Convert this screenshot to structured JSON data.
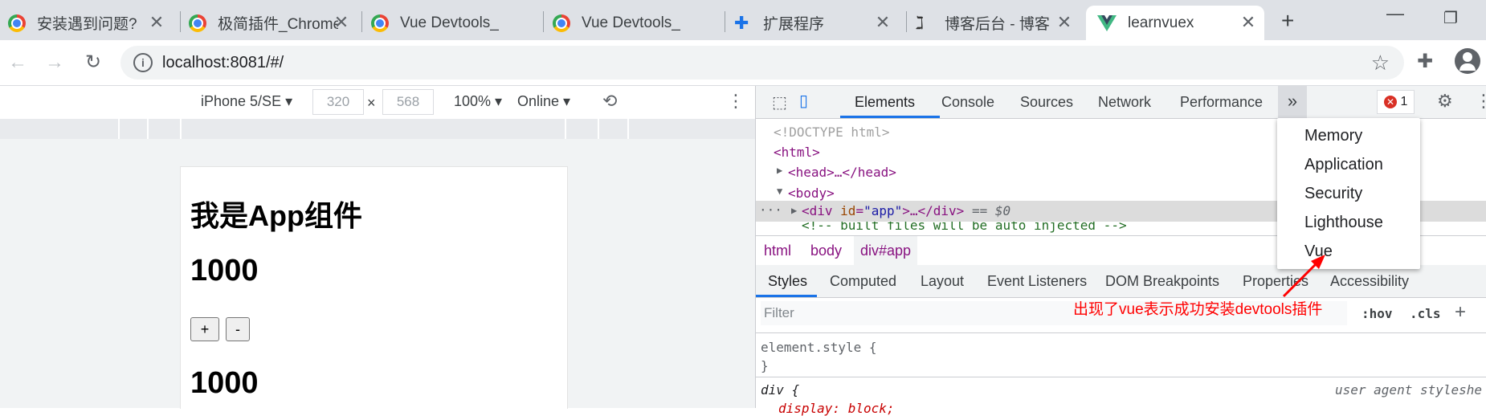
{
  "tabs": [
    {
      "title": "安装遇到问题?",
      "icon": "chrome-icon"
    },
    {
      "title": "极简插件_Chrome",
      "icon": "chrome-icon"
    },
    {
      "title": "Vue Devtools_",
      "icon": "chrome-icon"
    },
    {
      "title": "Vue Devtools_",
      "icon": "chrome-icon"
    },
    {
      "title": "扩展程序",
      "icon": "puzzle-icon"
    },
    {
      "title": "博客后台 - 博客",
      "icon": "blog-icon"
    },
    {
      "title": "learnvuex",
      "icon": "vue-icon"
    }
  ],
  "address": {
    "url": "localhost:8081/#/"
  },
  "device_toolbar": {
    "device": "iPhone 5/SE",
    "width": "320",
    "x": "×",
    "height": "568",
    "zoom": "100%",
    "network": "Online"
  },
  "page": {
    "heading": "我是App组件",
    "counter1": "1000",
    "plus": "+",
    "minus": "-",
    "counter2": "1000"
  },
  "devtools": {
    "tabs": [
      "Elements",
      "Console",
      "Sources",
      "Network",
      "Performance"
    ],
    "more": "»",
    "errors": "1",
    "dom": {
      "doctype": "<!DOCTYPE html>",
      "html": "<html>",
      "head": "<head>…</head>",
      "body": "<body>",
      "div_open": "<div",
      "div_attr": "id",
      "div_eq": "=",
      "div_val": "\"app\"",
      "div_close": ">…</div>",
      "eq0": "== $0",
      "comment": "<!-- built files will be auto injected -->"
    },
    "breadcrumbs": [
      "html",
      "body",
      "div#app"
    ],
    "subtabs": [
      "Styles",
      "Computed",
      "Layout",
      "Event Listeners",
      "DOM Breakpoints",
      "Properties",
      "Accessibility"
    ],
    "filter_placeholder": "Filter",
    "hov": ":hov",
    "cls": ".cls",
    "plus": "+",
    "style_rules": {
      "element_style": "element.style {",
      "close": "}",
      "div_rule": "div {",
      "ua": "user agent styleshe",
      "display": "display: block;"
    },
    "overflow_menu": [
      "Memory",
      "Application",
      "Security",
      "Lighthouse",
      "Vue"
    ]
  },
  "annotation": {
    "text": "出现了vue表示成功安装devtools插件",
    "color": "#ff0000"
  },
  "colors": {
    "accent": "#1a73e8",
    "vue_green": "#41b883",
    "error_red": "#d93025"
  }
}
